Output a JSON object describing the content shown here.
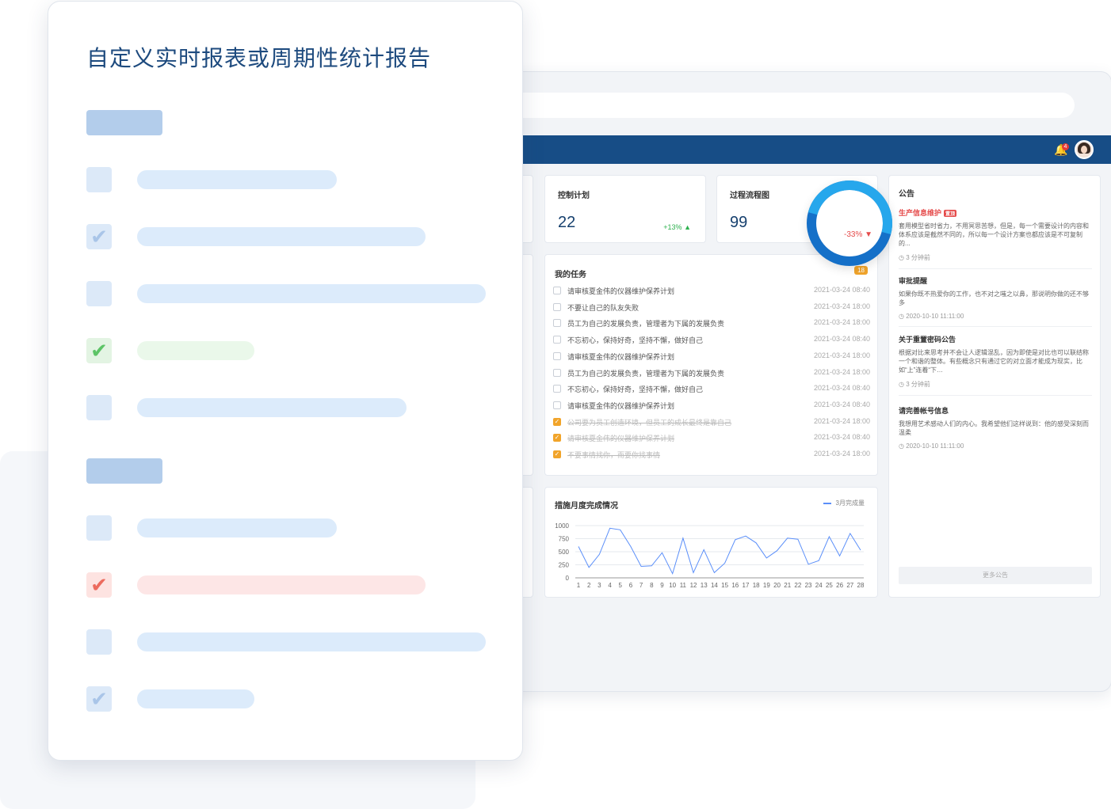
{
  "front_card": {
    "title": "自定义实时报表或周期性统计报告",
    "items": [
      {
        "state": "empty",
        "icon": "checkbox-empty"
      },
      {
        "state": "checked-blue",
        "icon": "checkmark-icon",
        "mark": "✔"
      },
      {
        "state": "empty",
        "icon": "checkbox-empty"
      },
      {
        "state": "checked-green",
        "icon": "checkmark-icon",
        "mark": "✔"
      },
      {
        "state": "empty",
        "icon": "checkbox-empty"
      },
      {
        "state": "empty",
        "icon": "checkbox-empty"
      },
      {
        "state": "checked-red",
        "icon": "checkmark-icon",
        "mark": "✔"
      },
      {
        "state": "empty",
        "icon": "checkbox-empty"
      },
      {
        "state": "checked-blue",
        "icon": "checkmark-icon",
        "mark": "✔"
      }
    ],
    "colors": {
      "blue": "#dcebfb",
      "green": "#eaf8ea",
      "red": "#fde6e6",
      "header": "#b3cdeb"
    }
  },
  "dashboard": {
    "nav": {
      "bell_count": "4",
      "icons": [
        "bell-icon",
        "avatar"
      ]
    },
    "stats": [
      {
        "title": "控制计划",
        "value": "22",
        "change": "+13%",
        "direction": "up"
      },
      {
        "title": "过程流程图",
        "value": "99",
        "change": "-33%",
        "direction": "down"
      }
    ],
    "tasks": {
      "title": "我的任务",
      "count": "18",
      "items": [
        {
          "text": "请审核夏金伟的仪器维护保养计划",
          "date": "2021-03-24 08:40",
          "done": false
        },
        {
          "text": "不要让自己的队友失败",
          "date": "2021-03-24 18:00",
          "done": false
        },
        {
          "text": "员工为自己的发展负责，管理者为下属的发展负责",
          "date": "2021-03-24 18:00",
          "done": false
        },
        {
          "text": "不忘初心，保持好奇，坚持不懈，做好自己",
          "date": "2021-03-24 08:40",
          "done": false
        },
        {
          "text": "请审核夏金伟的仪器维护保养计划",
          "date": "2021-03-24 18:00",
          "done": false
        },
        {
          "text": "员工为自己的发展负责，管理者为下属的发展负责",
          "date": "2021-03-24 18:00",
          "done": false
        },
        {
          "text": "不忘初心，保持好奇，坚持不懈，做好自己",
          "date": "2021-03-24 08:40",
          "done": false
        },
        {
          "text": "请审核夏金伟的仪器维护保养计划",
          "date": "2021-03-24 08:40",
          "done": false
        },
        {
          "text": "公司要为员工创造环境，但员工的成长最终是靠自己",
          "date": "2021-03-24 18:00",
          "done": true
        },
        {
          "text": "请审核夏金伟的仪器维护保养计划",
          "date": "2021-03-24 08:40",
          "done": true
        },
        {
          "text": "不要事情找你，而要你找事情",
          "date": "2021-03-24 18:00",
          "done": true
        }
      ]
    },
    "notices": {
      "title": "公告",
      "more": "更多公告",
      "items": [
        {
          "title": "生产信息维护",
          "tag": "置顶",
          "body": "套用模型省时省力，不用冥思苦想，但是，每一个需要设计的内容和体系应该是截然不同的，所以每一个设计方案也都应该是不可复制的...",
          "time": "3 分钟前",
          "highlight": true
        },
        {
          "title": "审批提醒",
          "tag": "",
          "body": "如果你既不热爱你的工作，也不对之嗤之以鼻，那说明你做的还不够多",
          "time": "2020-10-10 11:11:00",
          "highlight": false
        },
        {
          "title": "关于重置密码公告",
          "tag": "",
          "body": "根据对比来思考并不会让人逻辑混乱，因为即使是对比也可以联结称一个和谐的整体。有些概念只有通过它的对立面才能成为现实，比如“上”连着“下…",
          "time": "3 分钟前",
          "highlight": false
        },
        {
          "title": "请完善帐号信息",
          "tag": "",
          "body": "我想用艺术感动人们的内心。我希望他们这样说到：他的感受深刻而温柔",
          "time": "2020-10-10 11:11:00",
          "highlight": false
        }
      ]
    }
  },
  "chart_data": {
    "type": "line",
    "title": "措施月度完成情况",
    "series": [
      {
        "name": "3月完成量",
        "color": "#5b8ff9",
        "values": [
          600,
          200,
          450,
          950,
          920,
          600,
          220,
          230,
          480,
          80,
          760,
          100,
          540,
          100,
          280,
          730,
          800,
          670,
          380,
          520,
          760,
          740,
          260,
          330,
          790,
          420,
          850,
          530
        ]
      }
    ],
    "x": [
      1,
      2,
      3,
      4,
      5,
      6,
      7,
      8,
      9,
      10,
      11,
      12,
      13,
      14,
      15,
      16,
      17,
      18,
      19,
      20,
      21,
      22,
      23,
      24,
      25,
      26,
      27,
      28
    ],
    "ylim": [
      0,
      1000
    ],
    "yticks": [
      0,
      250,
      500,
      750,
      1000
    ],
    "grid": true,
    "legend": "top-right"
  }
}
